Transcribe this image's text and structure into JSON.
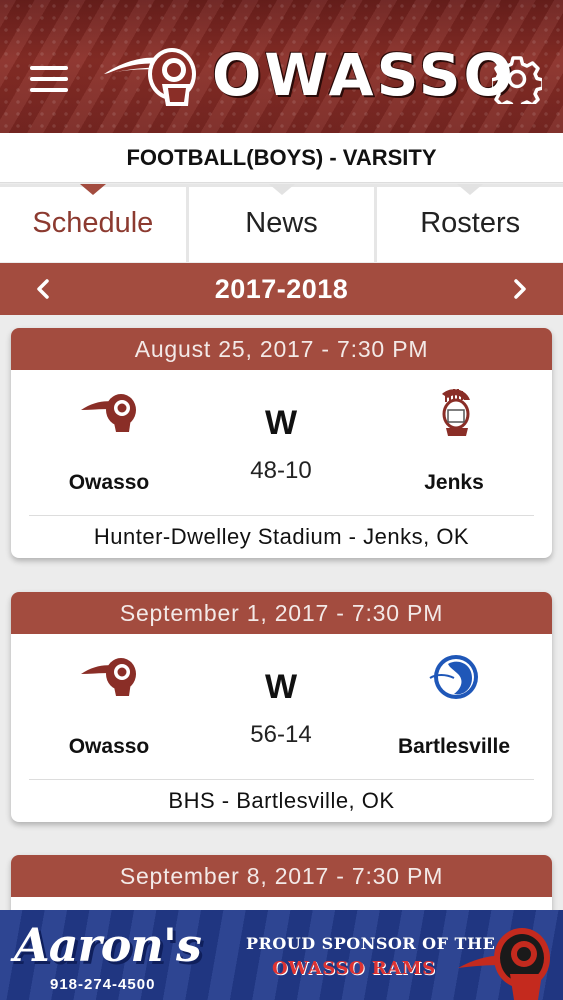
{
  "header": {
    "brand": "OWASSO",
    "menu_icon": "hamburger-menu-icon",
    "settings_icon": "gear-icon",
    "logo": "rams-logo"
  },
  "sport_title": "FOOTBALL(BOYS) - VARSITY",
  "tabs": [
    {
      "label": "Schedule",
      "active": true
    },
    {
      "label": "News",
      "active": false
    },
    {
      "label": "Rosters",
      "active": false
    }
  ],
  "season": {
    "label": "2017-2018",
    "prev_icon": "chevron-left-icon",
    "next_icon": "chevron-right-icon"
  },
  "games": [
    {
      "datetime": "August 25, 2017 - 7:30 PM",
      "home_team": "Owasso",
      "result": "W",
      "score": "48-10",
      "away_team": "Jenks",
      "venue": "Hunter-Dwelley Stadium - Jenks, OK"
    },
    {
      "datetime": "September 1, 2017 - 7:30 PM",
      "home_team": "Owasso",
      "result": "W",
      "score": "56-14",
      "away_team": "Bartlesville",
      "venue": "BHS - Bartlesville, OK"
    },
    {
      "datetime": "September 8, 2017 - 7:30 PM"
    }
  ],
  "ad": {
    "brand": "Aaron's",
    "phone": "918-274-4500",
    "line1": "PROUD SPONSOR OF THE",
    "line2": "OWASSO RAMS"
  },
  "colors": {
    "primary": "#a34c3f",
    "header_dark": "#6b1f1c",
    "ad_blue": "#233b8c",
    "active_tab_text": "#8c3a30"
  }
}
